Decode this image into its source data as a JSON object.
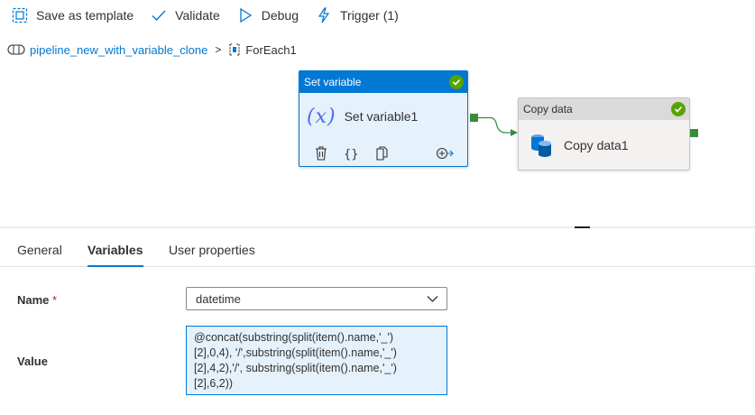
{
  "toolbar": {
    "save_template": "Save as template",
    "validate": "Validate",
    "debug": "Debug",
    "trigger": "Trigger (1)"
  },
  "breadcrumb": {
    "pipeline": "pipeline_new_with_variable_clone",
    "separator": ">",
    "current": "ForEach1"
  },
  "canvas": {
    "set_variable": {
      "type_label": "Set variable",
      "name": "Set variable1",
      "status": "succeeded"
    },
    "copy_data": {
      "type_label": "Copy data",
      "name": "Copy data1",
      "status": "succeeded"
    }
  },
  "tabs": [
    "General",
    "Variables",
    "User properties"
  ],
  "active_tab": "Variables",
  "form": {
    "name_label": "Name",
    "required_mark": "*",
    "name_value": "datetime",
    "value_label": "Value",
    "value_lines": [
      "@concat(substring(split(item().name,'_')",
      "[2],0,4), '/',substring(split(item().name,'_')",
      "[2],4,2),'/', substring(split(item().name,'_')",
      "[2],6,2))"
    ]
  },
  "colors": {
    "accent": "#0078d4",
    "success": "#57a300",
    "port": "#3a8a3e"
  }
}
